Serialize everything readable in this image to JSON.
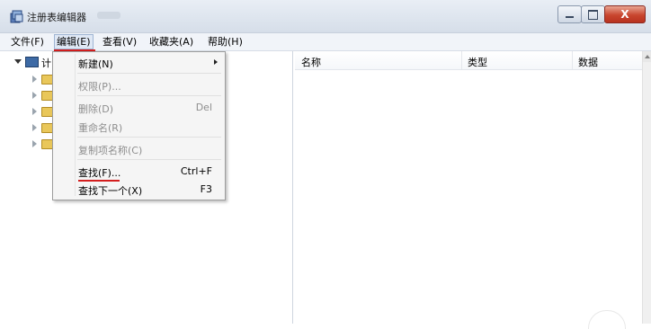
{
  "window": {
    "title": "注册表编辑器",
    "buttons": {
      "minimize": "—",
      "maximize": "□",
      "close": "X"
    }
  },
  "menubar": {
    "items": [
      "文件(F)",
      "编辑(E)",
      "查看(V)",
      "收藏夹(A)",
      "帮助(H)"
    ],
    "active": "编辑(E)"
  },
  "tree": {
    "root_label": "计",
    "icons": {
      "root": "computer-icon",
      "child": "folder-icon"
    }
  },
  "list": {
    "columns": [
      "名称",
      "类型",
      "数据"
    ]
  },
  "edit_menu": {
    "items": [
      {
        "label": "新建(N)",
        "shortcut": "",
        "disabled": false,
        "submenu": true
      },
      {
        "label": "权限(P)...",
        "shortcut": "",
        "disabled": true
      },
      {
        "label": "删除(D)",
        "shortcut": "Del",
        "disabled": true
      },
      {
        "label": "重命名(R)",
        "shortcut": "",
        "disabled": true
      },
      {
        "label": "复制项名称(C)",
        "shortcut": "",
        "disabled": true
      },
      {
        "label": "查找(F)...",
        "shortcut": "Ctrl+F",
        "disabled": false
      },
      {
        "label": "查找下一个(X)",
        "shortcut": "F3",
        "disabled": false
      }
    ]
  },
  "colors": {
    "highlight_underline": "#d31e1e",
    "close_button": "#c8452e"
  }
}
